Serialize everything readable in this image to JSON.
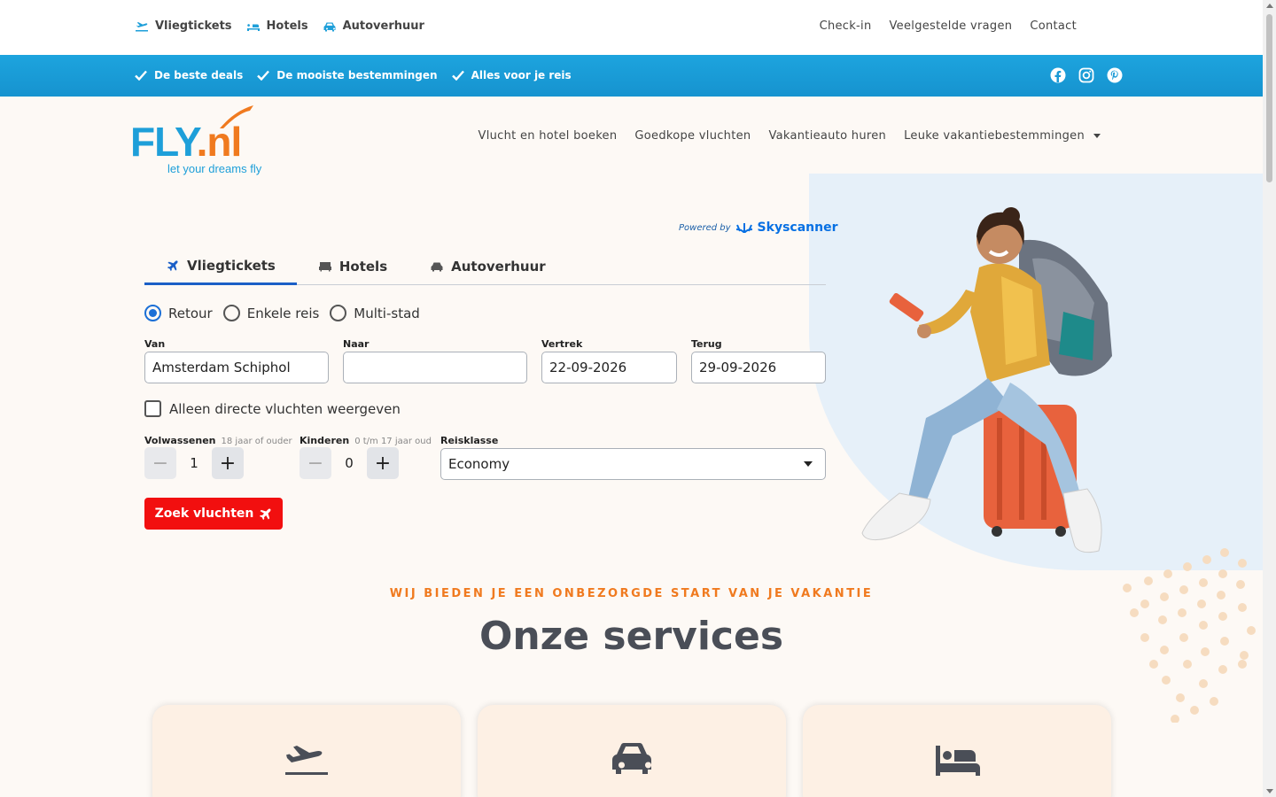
{
  "topbar": {
    "left": [
      "Vliegtickets",
      "Hotels",
      "Autoverhuur"
    ],
    "right": [
      "Check-in",
      "Veelgestelde vragen",
      "Contact"
    ]
  },
  "usps": [
    "De beste deals",
    "De mooiste bestemmingen",
    "Alles voor je reis"
  ],
  "social": [
    "facebook-icon",
    "instagram-icon",
    "pinterest-icon"
  ],
  "logo": {
    "word": "FLY",
    "suffix": ".nl",
    "tagline": "let your dreams fly"
  },
  "mainnav": [
    "Vlucht en hotel boeken",
    "Goedkope vluchten",
    "Vakantieauto huren",
    "Leuke vakantiebestemmingen"
  ],
  "widget": {
    "powered_by": "Powered by",
    "provider": "Skyscanner",
    "tabs": [
      "Vliegtickets",
      "Hotels",
      "Autoverhuur"
    ],
    "trip_types": [
      "Retour",
      "Enkele reis",
      "Multi-stad"
    ],
    "selected_trip": "Retour",
    "from": {
      "label": "Van",
      "value": "Amsterdam Schiphol"
    },
    "to": {
      "label": "Naar",
      "value": ""
    },
    "depart": {
      "label": "Vertrek",
      "value": "22-09-2026"
    },
    "return": {
      "label": "Terug",
      "value": "29-09-2026"
    },
    "direct_only": "Alleen directe vluchten weergeven",
    "adults": {
      "label": "Volwassenen",
      "hint": "18 jaar of ouder",
      "value": "1"
    },
    "children": {
      "label": "Kinderen",
      "hint": "0 t/m 17 jaar oud",
      "value": "0"
    },
    "class": {
      "label": "Reisklasse",
      "value": "Economy"
    },
    "search_label": "Zoek vluchten"
  },
  "services": {
    "eyebrow": "WIJ BIEDEN JE EEN ONBEZORGDE START VAN JE VAKANTIE",
    "title": "Onze services",
    "cards": [
      "plane-departure-icon",
      "car-icon",
      "bed-icon"
    ]
  },
  "colors": {
    "brand_blue": "#1e9fd9",
    "brand_orange": "#f07a1f",
    "cta_red": "#f20f0f",
    "tab_active": "#1b5fc7"
  }
}
